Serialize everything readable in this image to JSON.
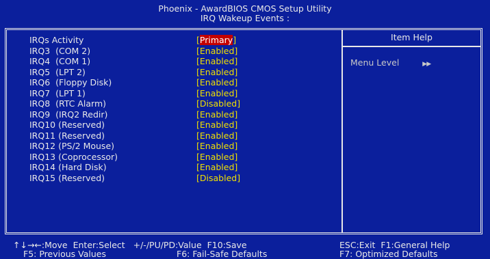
{
  "title": {
    "line1": "Phoenix - AwardBIOS CMOS Setup Utility",
    "line2": "IRQ Wakeup Events :"
  },
  "help": {
    "header": "Item Help",
    "menu_level_label": "Menu Level",
    "menu_level_arrows": "▶▶"
  },
  "items": [
    {
      "label": "IRQs Activity",
      "value": "Primary",
      "selected": true
    },
    {
      "label": "IRQ3  (COM 2)",
      "value": "Enabled"
    },
    {
      "label": "IRQ4  (COM 1)",
      "value": "Enabled"
    },
    {
      "label": "IRQ5  (LPT 2)",
      "value": "Enabled"
    },
    {
      "label": "IRQ6  (Floppy Disk)",
      "value": "Enabled"
    },
    {
      "label": "IRQ7  (LPT 1)",
      "value": "Enabled"
    },
    {
      "label": "IRQ8  (RTC Alarm)",
      "value": "Disabled"
    },
    {
      "label": "IRQ9  (IRQ2 Redir)",
      "value": "Enabled"
    },
    {
      "label": "IRQ10 (Reserved)",
      "value": "Enabled"
    },
    {
      "label": "IRQ11 (Reserved)",
      "value": "Enabled"
    },
    {
      "label": "IRQ12 (PS/2 Mouse)",
      "value": "Enabled"
    },
    {
      "label": "IRQ13 (Coprocessor)",
      "value": "Enabled"
    },
    {
      "label": "IRQ14 (Hard Disk)",
      "value": "Enabled"
    },
    {
      "label": "IRQ15 (Reserved)",
      "value": "Disabled"
    }
  ],
  "footer": {
    "move": "↑↓→←:Move",
    "enter": "Enter:Select",
    "value": "+/-/PU/PD:Value",
    "save": "F10:Save",
    "exit": "ESC:Exit",
    "help": "F1:General Help",
    "prev": "F5: Previous Values",
    "failsafe": "F6: Fail-Safe Defaults",
    "optimized": "F7: Optimized Defaults"
  },
  "colors": {
    "background": "#0b1f9c",
    "text": "#e8e8e8",
    "value": "#f0e000",
    "selected_bg": "#c40000"
  }
}
